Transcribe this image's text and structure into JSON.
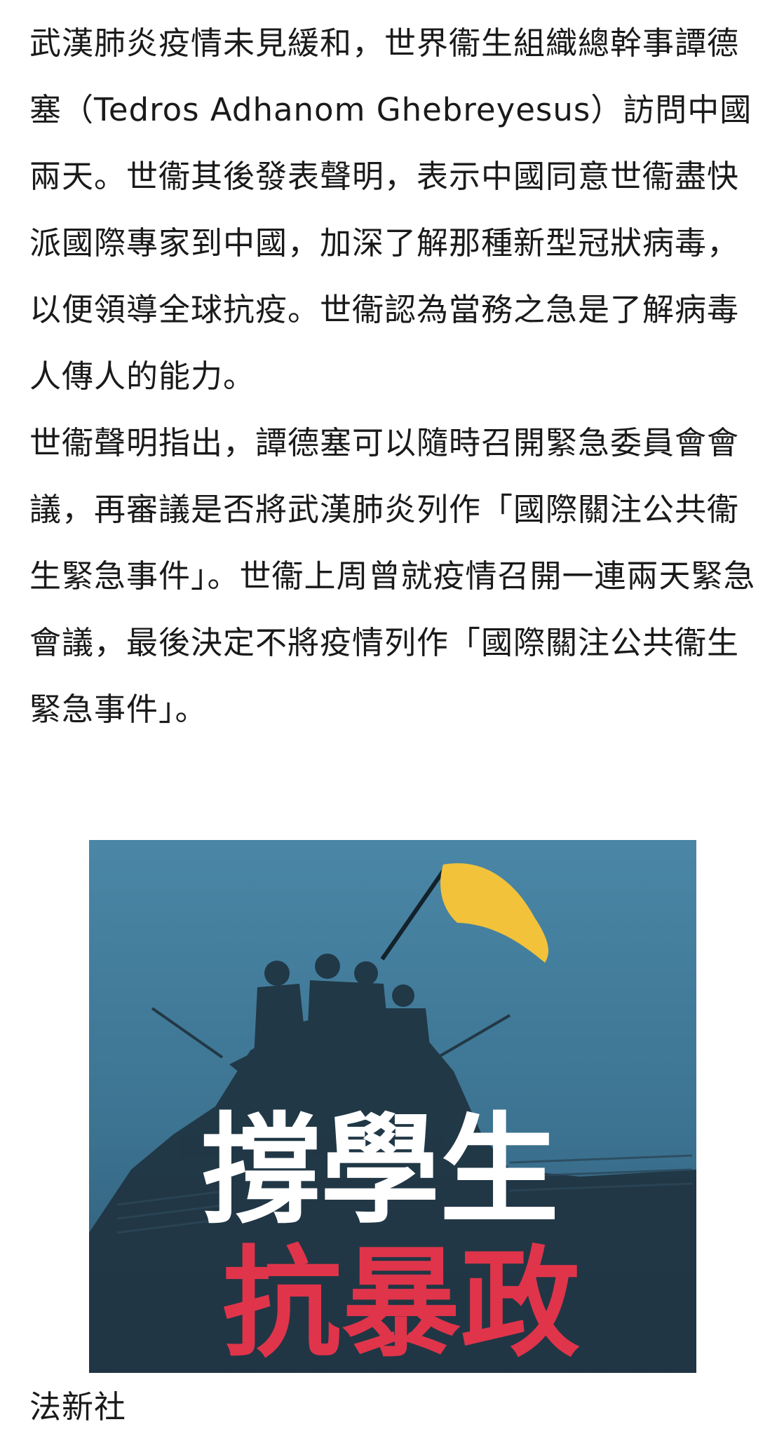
{
  "article": {
    "paragraphs": [
      "武漢肺炎疫情未見緩和，世界衞生組織總幹事譚德塞（Tedros Adhanom Ghebreyesus）訪問中國兩天。世衞其後發表聲明，表示中國同意世衞盡快派國際專家到中國，加深了解那種新型冠狀病毒，以便領導全球抗疫。世衞認為當務之急是了解病毒人傳人的能力。",
      "世衞聲明指出，譚德塞可以隨時召開緊急委員會會議，再審議是否將武漢肺炎列作「國際關注公共衞生緊急事件」。世衞上周曾就疫情召開一連兩天緊急會議，最後決定不將疫情列作「國際關注公共衞生緊急事件」。"
    ]
  },
  "figure": {
    "headline_white": "撐學生",
    "headline_red": "抗暴政",
    "flag_color": "#f2c23a",
    "background_color": "#3f7593",
    "red_color": "#e0344a"
  },
  "caption": "法新社"
}
